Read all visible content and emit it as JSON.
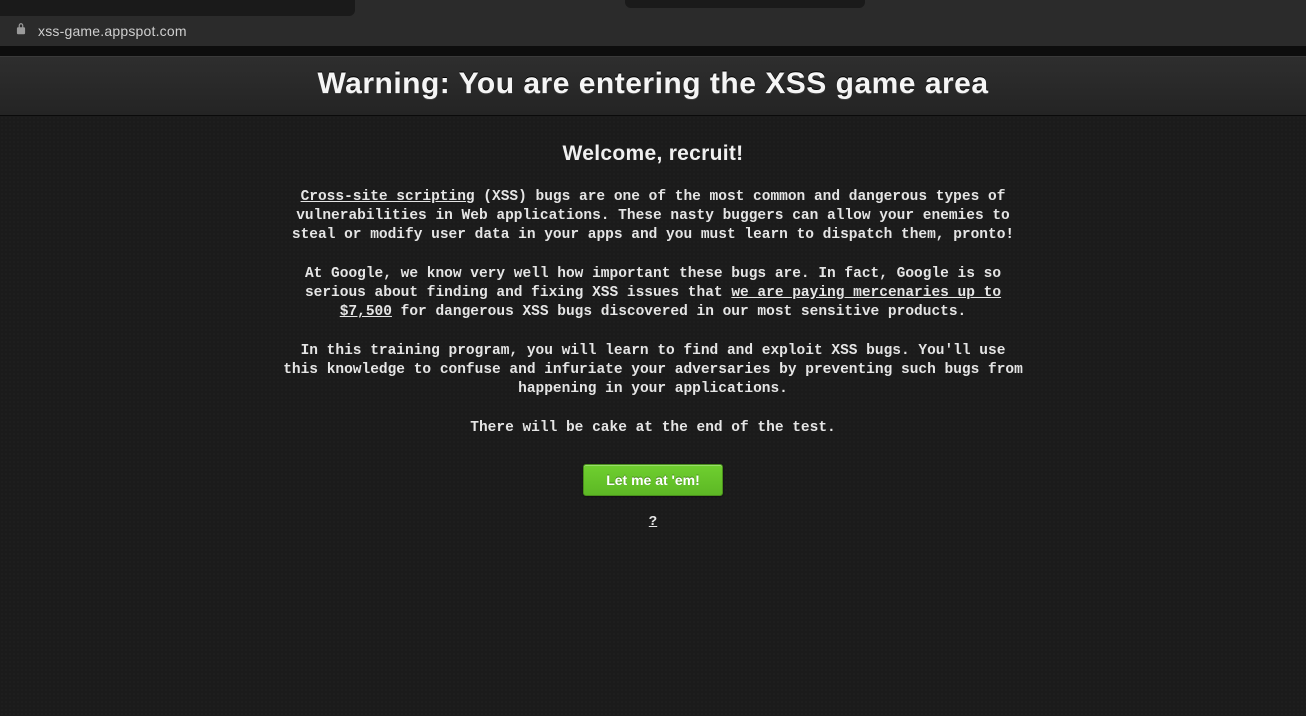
{
  "browser": {
    "url": "xss-game.appspot.com"
  },
  "banner": {
    "title": "Warning: You are entering the XSS game area"
  },
  "content": {
    "subheading": "Welcome, recruit!",
    "p1_link": "Cross-site scripting",
    "p1_rest": " (XSS) bugs are one of the most common and dangerous types of vulnerabilities in Web applications. These nasty buggers can allow your enemies to steal or modify user data in your apps and you must learn to dispatch them, pronto!",
    "p2_before": "At Google, we know very well how important these bugs are. In fact, Google is so serious about finding and fixing XSS issues that ",
    "p2_link": "we are paying mercenaries up to $7,500",
    "p2_after": " for dangerous XSS bugs discovered in our most sensitive products.",
    "p3": "In this training program, you will learn to find and exploit XSS bugs. You'll use this knowledge to confuse and infuriate your adversaries by preventing such bugs from happening in your applications.",
    "p4": "There will be cake at the end of the test.",
    "cta_label": "Let me at 'em!",
    "footer_glyph": "?"
  }
}
